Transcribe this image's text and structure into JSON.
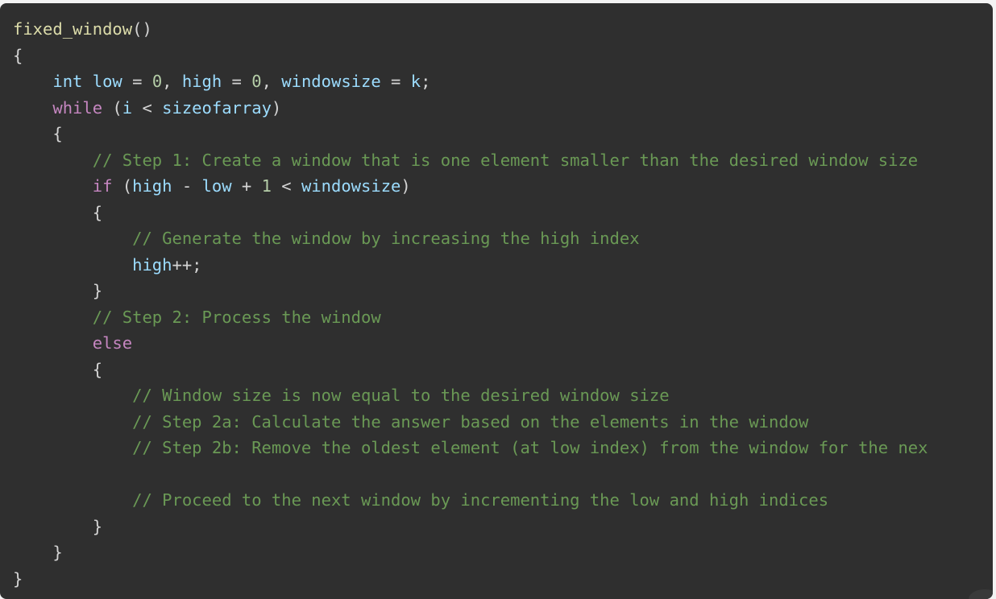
{
  "code": {
    "language": "c-like",
    "lines": [
      [
        {
          "t": "fixed_window",
          "c": "fn"
        },
        {
          "t": "()",
          "c": "punc"
        }
      ],
      [
        {
          "t": "{",
          "c": "punc"
        }
      ],
      [
        {
          "t": "    ",
          "c": "text"
        },
        {
          "t": "int",
          "c": "type"
        },
        {
          "t": " ",
          "c": "text"
        },
        {
          "t": "low",
          "c": "var"
        },
        {
          "t": " = ",
          "c": "op"
        },
        {
          "t": "0",
          "c": "num"
        },
        {
          "t": ", ",
          "c": "punc"
        },
        {
          "t": "high",
          "c": "var"
        },
        {
          "t": " = ",
          "c": "op"
        },
        {
          "t": "0",
          "c": "num"
        },
        {
          "t": ", ",
          "c": "punc"
        },
        {
          "t": "windowsize",
          "c": "var"
        },
        {
          "t": " = ",
          "c": "op"
        },
        {
          "t": "k",
          "c": "var"
        },
        {
          "t": ";",
          "c": "punc"
        }
      ],
      [
        {
          "t": "    ",
          "c": "text"
        },
        {
          "t": "while",
          "c": "kw"
        },
        {
          "t": " (",
          "c": "punc"
        },
        {
          "t": "i",
          "c": "var"
        },
        {
          "t": " < ",
          "c": "op"
        },
        {
          "t": "sizeofarray",
          "c": "var"
        },
        {
          "t": ")",
          "c": "punc"
        }
      ],
      [
        {
          "t": "    {",
          "c": "punc"
        }
      ],
      [
        {
          "t": "        ",
          "c": "text"
        },
        {
          "t": "// Step 1: Create a window that is one element smaller than the desired window size",
          "c": "comment"
        }
      ],
      [
        {
          "t": "        ",
          "c": "text"
        },
        {
          "t": "if",
          "c": "kw"
        },
        {
          "t": " (",
          "c": "punc"
        },
        {
          "t": "high",
          "c": "var"
        },
        {
          "t": " - ",
          "c": "op"
        },
        {
          "t": "low",
          "c": "var"
        },
        {
          "t": " + ",
          "c": "op"
        },
        {
          "t": "1",
          "c": "num"
        },
        {
          "t": " < ",
          "c": "op"
        },
        {
          "t": "windowsize",
          "c": "var"
        },
        {
          "t": ")",
          "c": "punc"
        }
      ],
      [
        {
          "t": "        {",
          "c": "punc"
        }
      ],
      [
        {
          "t": "            ",
          "c": "text"
        },
        {
          "t": "// Generate the window by increasing the high index",
          "c": "comment"
        }
      ],
      [
        {
          "t": "            ",
          "c": "text"
        },
        {
          "t": "high",
          "c": "var"
        },
        {
          "t": "++;",
          "c": "punc"
        }
      ],
      [
        {
          "t": "        }",
          "c": "punc"
        }
      ],
      [
        {
          "t": "        ",
          "c": "text"
        },
        {
          "t": "// Step 2: Process the window",
          "c": "comment"
        }
      ],
      [
        {
          "t": "        ",
          "c": "text"
        },
        {
          "t": "else",
          "c": "kw"
        }
      ],
      [
        {
          "t": "        {",
          "c": "punc"
        }
      ],
      [
        {
          "t": "            ",
          "c": "text"
        },
        {
          "t": "// Window size is now equal to the desired window size",
          "c": "comment"
        }
      ],
      [
        {
          "t": "            ",
          "c": "text"
        },
        {
          "t": "// Step 2a: Calculate the answer based on the elements in the window",
          "c": "comment"
        }
      ],
      [
        {
          "t": "            ",
          "c": "text"
        },
        {
          "t": "// Step 2b: Remove the oldest element (at low index) from the window for the nex",
          "c": "comment"
        }
      ],
      [
        {
          "t": "",
          "c": "text"
        }
      ],
      [
        {
          "t": "            ",
          "c": "text"
        },
        {
          "t": "// Proceed to the next window by incrementing the low and high indices",
          "c": "comment"
        }
      ],
      [
        {
          "t": "        }",
          "c": "punc"
        }
      ],
      [
        {
          "t": "    }",
          "c": "punc"
        }
      ],
      [
        {
          "t": "}",
          "c": "punc"
        }
      ]
    ]
  },
  "colors": {
    "background": "#2f2f2f",
    "function": "#dcdcaa",
    "keyword": "#c586c0",
    "variable": "#9cdcfe",
    "number": "#b5cea8",
    "comment": "#6a9955",
    "text": "#d4d4d4"
  }
}
